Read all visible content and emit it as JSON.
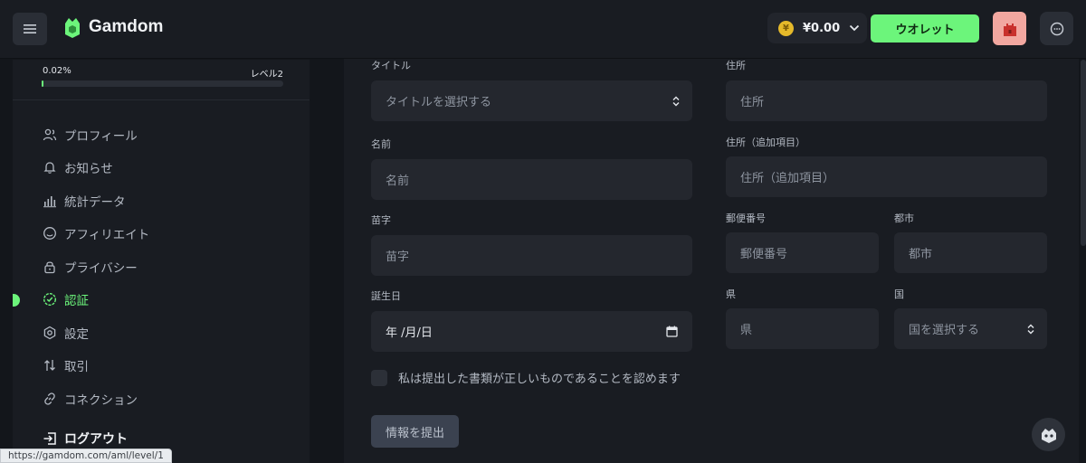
{
  "brand": {
    "name": "Gamdom",
    "accent": "#6cf57b"
  },
  "header": {
    "balance_symbol": "¥",
    "balance": "¥0.00",
    "wallet_label": "ウオレット"
  },
  "sidebar": {
    "level_percent": "0.02%",
    "level_progress": 0.0002,
    "level_label": "レベル2",
    "items": [
      {
        "label": "プロフィール",
        "icon": "profile-icon"
      },
      {
        "label": "お知らせ",
        "icon": "bell-icon"
      },
      {
        "label": "統計データ",
        "icon": "stats-icon"
      },
      {
        "label": "アフィリエイト",
        "icon": "smile-icon"
      },
      {
        "label": "プライバシー",
        "icon": "lock-icon"
      },
      {
        "label": "認証",
        "icon": "verify-icon",
        "active": true
      },
      {
        "label": "設定",
        "icon": "settings-icon"
      },
      {
        "label": "取引",
        "icon": "transfer-icon"
      },
      {
        "label": "コネクション",
        "icon": "link-icon"
      }
    ],
    "logout_label": "ログアウト"
  },
  "form": {
    "title_label": "タイトル",
    "title_placeholder": "タイトルを選択する",
    "first_name_label": "名前",
    "first_name_placeholder": "名前",
    "last_name_label": "苗字",
    "last_name_placeholder": "苗字",
    "birthdate_label": "誕生日",
    "birthdate_value": "年 /月/日",
    "address_label": "住所",
    "address_placeholder": "住所",
    "address2_label": "住所（追加項目）",
    "address2_placeholder": "住所（追加項目）",
    "postal_label": "郵便番号",
    "postal_placeholder": "郵便番号",
    "city_label": "都市",
    "city_placeholder": "都市",
    "state_label": "県",
    "state_placeholder": "県",
    "country_label": "国",
    "country_placeholder": "国を選択する",
    "confirm_text": "私は提出した書類が正しいものであることを認めます",
    "submit_label": "情報を提出"
  },
  "status_bar": {
    "url": "https://gamdom.com/aml/level/1"
  }
}
